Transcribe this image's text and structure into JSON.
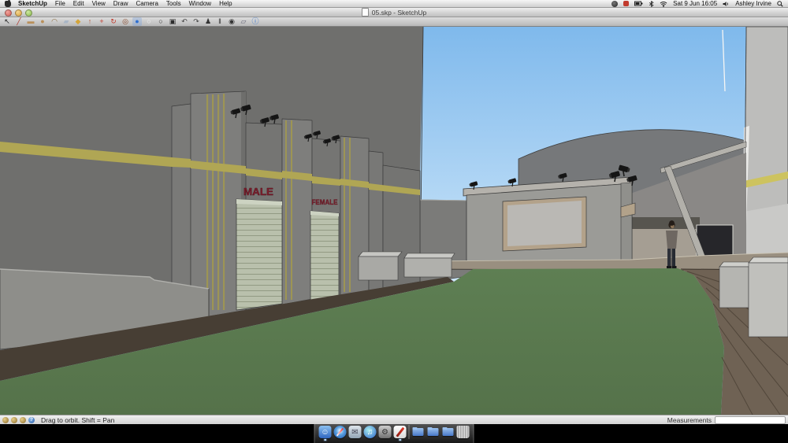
{
  "menu_bar": {
    "app_name": "SketchUp",
    "items": [
      "File",
      "Edit",
      "View",
      "Draw",
      "Camera",
      "Tools",
      "Window",
      "Help"
    ],
    "date_time": "Sat 9 Jun 16:05",
    "user_name": "Ashley Irvine"
  },
  "window": {
    "title": "05.skp - SketchUp"
  },
  "toolbar": {
    "tools": [
      "select",
      "line",
      "rectangle",
      "circle",
      "arc",
      "eraser",
      "paint-bucket",
      "push-pull",
      "move",
      "rotate",
      "offset",
      "orbit",
      "pan",
      "zoom",
      "zoom-extents",
      "previous-view",
      "next-view",
      "position-camera",
      "walk",
      "look-around",
      "section-plane",
      "model-info"
    ]
  },
  "viewport": {
    "male_sign": "MALE",
    "female_sign": "FEMALE"
  },
  "status_bar": {
    "hint": "Drag to orbit.  Shift = Pan",
    "measurements_label": "Measurements",
    "measurements_value": ""
  },
  "dock": {
    "items": [
      "finder",
      "safari",
      "mail",
      "itunes",
      "system-preferences",
      "sketchup",
      "separator",
      "folder-1",
      "folder-2",
      "folder-3",
      "trash"
    ],
    "running": [
      "finder",
      "sketchup"
    ]
  },
  "colors": {
    "sky_top": "#7fb9ec",
    "sky_horizon": "#d2e9fa",
    "grass": "#5b7a50",
    "wall_gray": "#6f6f6d",
    "stripe_yellow": "#b0a654",
    "sign_red": "#7e1f2d",
    "door_green": "#b9c0ac"
  }
}
